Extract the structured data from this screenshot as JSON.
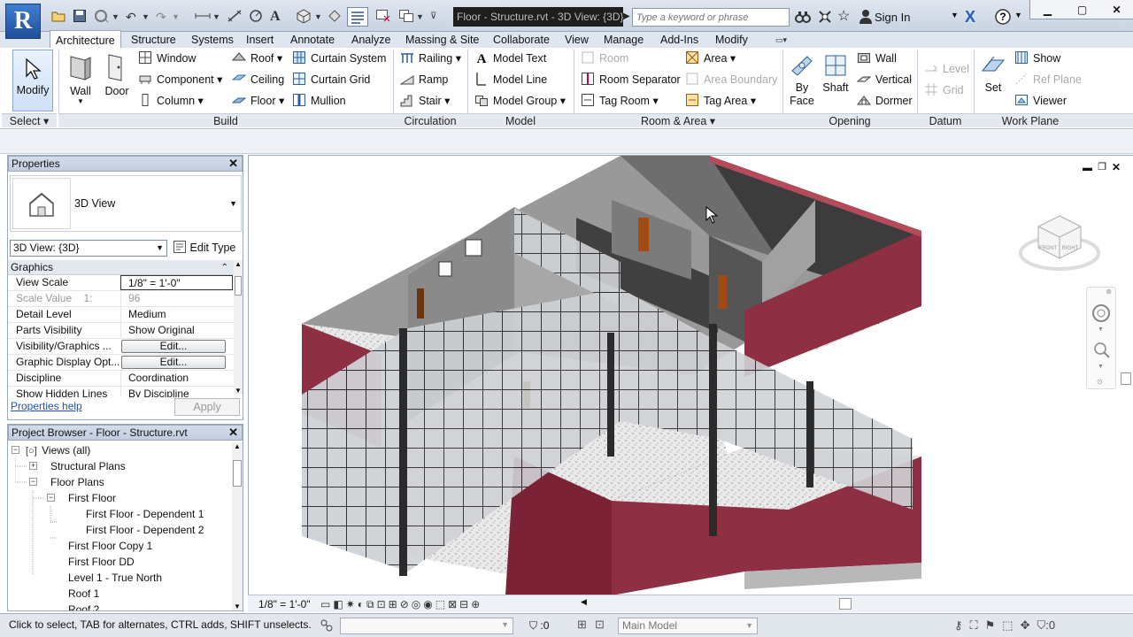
{
  "titlebar": {
    "document_title": "Floor - Structure.rvt - 3D View: {3D}",
    "search_placeholder": "Type a keyword or phrase",
    "sign_in": "Sign In"
  },
  "tabs": [
    "Architecture",
    "Structure",
    "Systems",
    "Insert",
    "Annotate",
    "Analyze",
    "Massing & Site",
    "Collaborate",
    "View",
    "Manage",
    "Add-Ins",
    "Modify"
  ],
  "ribbon": {
    "select": {
      "modify": "Modify",
      "label": "Select"
    },
    "build": {
      "label": "Build",
      "wall": "Wall",
      "door": "Door",
      "window": "Window",
      "component": "Component",
      "column": "Column",
      "roof": "Roof",
      "ceiling": "Ceiling",
      "floor": "Floor",
      "curtain_system": "Curtain System",
      "curtain_grid": "Curtain Grid",
      "mullion": "Mullion"
    },
    "circulation": {
      "label": "Circulation",
      "railing": "Railing",
      "ramp": "Ramp",
      "stair": "Stair"
    },
    "model": {
      "label": "Model",
      "model_text": "Model Text",
      "model_line": "Model Line",
      "model_group": "Model Group"
    },
    "room_area": {
      "label": "Room & Area",
      "room": "Room",
      "room_separator": "Room Separator",
      "tag_room": "Tag Room",
      "area": "Area",
      "area_boundary": "Area Boundary",
      "tag_area": "Tag Area"
    },
    "opening": {
      "label": "Opening",
      "by_face_1": "By",
      "by_face_2": "Face",
      "shaft": "Shaft",
      "wall": "Wall",
      "vertical": "Vertical",
      "dormer": "Dormer"
    },
    "datum": {
      "label": "Datum",
      "level": "Level",
      "grid": "Grid"
    },
    "work_plane": {
      "label": "Work Plane",
      "set": "Set",
      "show": "Show",
      "ref_plane": "Ref Plane",
      "viewer": "Viewer"
    }
  },
  "properties": {
    "title": "Properties",
    "type_name": "3D View",
    "view_selector": "3D View: {3D}",
    "edit_type": "Edit Type",
    "section": "Graphics",
    "rows": [
      {
        "key": "View Scale",
        "value": "1/8\" = 1'-0\""
      },
      {
        "key": "Scale Value    1:",
        "value": "96"
      },
      {
        "key": "Detail Level",
        "value": "Medium"
      },
      {
        "key": "Parts Visibility",
        "value": "Show Original"
      },
      {
        "key": "Visibility/Graphics ...",
        "value": "Edit..."
      },
      {
        "key": "Graphic Display Opt...",
        "value": "Edit..."
      },
      {
        "key": "Discipline",
        "value": "Coordination"
      },
      {
        "key": "Show Hidden Lines",
        "value": "By Discipline"
      }
    ],
    "help_link": "Properties help",
    "apply": "Apply"
  },
  "browser": {
    "title": "Project Browser - Floor - Structure.rvt",
    "nodes": [
      {
        "label": "Views (all)",
        "indent": 0,
        "toggle": "-"
      },
      {
        "label": "Structural Plans",
        "indent": 1,
        "toggle": "+"
      },
      {
        "label": "Floor Plans",
        "indent": 1,
        "toggle": "-"
      },
      {
        "label": "First Floor",
        "indent": 2,
        "toggle": "-"
      },
      {
        "label": "First Floor - Dependent 1",
        "indent": 3,
        "toggle": ""
      },
      {
        "label": "First Floor - Dependent 2",
        "indent": 3,
        "toggle": ""
      },
      {
        "label": "First Floor Copy 1",
        "indent": 2,
        "toggle": ""
      },
      {
        "label": "First Floor DD",
        "indent": 2,
        "toggle": ""
      },
      {
        "label": "Level 1 - True North",
        "indent": 2,
        "toggle": ""
      },
      {
        "label": "Roof 1",
        "indent": 2,
        "toggle": ""
      },
      {
        "label": "Roof 2",
        "indent": 2,
        "toggle": ""
      }
    ]
  },
  "viewport": {
    "scale": "1/8\" = 1'-0\"",
    "viewcube_faces": [
      "FRONT",
      "RIGHT"
    ],
    "colors": {
      "wall_red": "#8e2f43",
      "glass": "#c9ccd0",
      "floor": "#e8e8e8",
      "interior_wall": "#8c8c8c"
    }
  },
  "status": {
    "message": "Click to select, TAB for alternates, CTRL adds, SHIFT unselects.",
    "filter_count": ":0",
    "workset": "Main Model",
    "selection_count": ":0"
  }
}
